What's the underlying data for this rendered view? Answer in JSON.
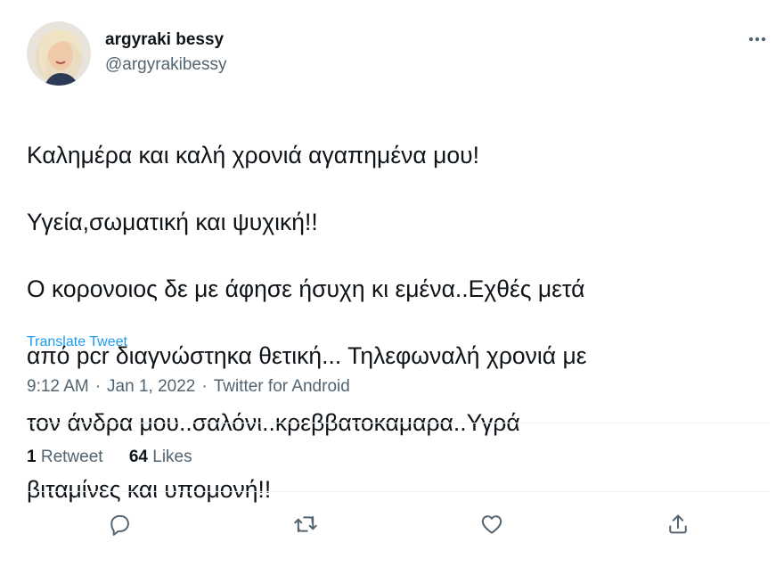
{
  "author": {
    "display_name": "argyraki bessy",
    "handle": "@argyrakibessy"
  },
  "tweet": {
    "text_lines": [
      "Καλημέρα και καλή χρονιά αγαπημένα μου!",
      "Υγεία,σωματική και ψυχική!!",
      "Ο κορονοιος δε με άφησε ήσυχη κι εμένα..Εχθές μετά",
      "από pcr διαγνώστηκα θετική... Τηλεφωναλή χρονιά με",
      "τον άνδρα μου..σαλόνι..κρεββατοκαμαρα..Υγρά",
      "βιταμίνες και υπομονή!!"
    ],
    "translate_label": "Translate Tweet"
  },
  "meta": {
    "time": "9:12 AM",
    "separator": "·",
    "date": "Jan 1, 2022",
    "source": "Twitter for Android"
  },
  "stats": {
    "retweets_count": "1",
    "retweets_label": "Retweet",
    "likes_count": "64",
    "likes_label": "Likes"
  },
  "actions": {
    "icons": [
      "reply-icon",
      "retweet-icon",
      "like-icon",
      "share-icon"
    ]
  },
  "colors": {
    "text": "#0f1419",
    "secondary": "#536471",
    "link": "#1d9bf0",
    "divider": "#eff3f4"
  }
}
